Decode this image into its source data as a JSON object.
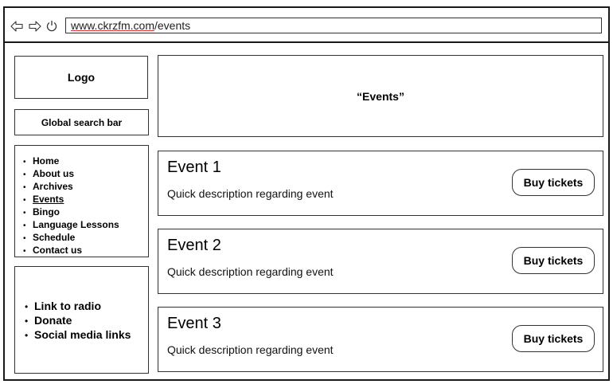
{
  "browser": {
    "url_domain": "www.ckrzfm.com",
    "url_path": "/events"
  },
  "sidebar": {
    "logo_label": "Logo",
    "search_label": "Global search bar",
    "nav_items": [
      {
        "label": "Home"
      },
      {
        "label": "About us"
      },
      {
        "label": "Archives"
      },
      {
        "label": "Events"
      },
      {
        "label": "Bingo"
      },
      {
        "label": "Language Lessons"
      },
      {
        "label": "Schedule"
      },
      {
        "label": "Contact us"
      }
    ],
    "active_nav": "Events",
    "extra_links": [
      {
        "label": "Link to radio"
      },
      {
        "label": "Donate"
      },
      {
        "label": "Social media links"
      }
    ]
  },
  "main": {
    "header_title": "“Events”",
    "events": [
      {
        "title": "Event 1",
        "description": "Quick description regarding event",
        "button_label": "Buy tickets"
      },
      {
        "title": "Event 2",
        "description": "Quick description regarding event",
        "button_label": "Buy tickets"
      },
      {
        "title": "Event 3",
        "description": "Quick description regarding event",
        "button_label": "Buy tickets"
      }
    ]
  },
  "icons": {
    "back": "back-arrow-icon",
    "forward": "forward-arrow-icon",
    "refresh": "refresh-icon"
  }
}
